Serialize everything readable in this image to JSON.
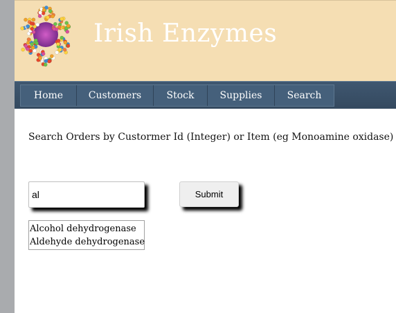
{
  "header": {
    "title": "Irish Enzymes",
    "logo_icon": "molecule-logo-icon",
    "background_color": "#f5deb3"
  },
  "nav": {
    "items": [
      {
        "label": "Home"
      },
      {
        "label": "Customers"
      },
      {
        "label": "Stock"
      },
      {
        "label": "Supplies"
      },
      {
        "label": "Search"
      }
    ],
    "background_color": "#3f5770"
  },
  "search": {
    "prompt": "Search Orders by Custormer Id (Integer) or Item (eg Monoamine oxidase)",
    "input_value": "al",
    "submit_label": "Submit",
    "suggestions": [
      "Alcohol dehydrogenase",
      "Aldehyde dehydrogenase"
    ]
  }
}
